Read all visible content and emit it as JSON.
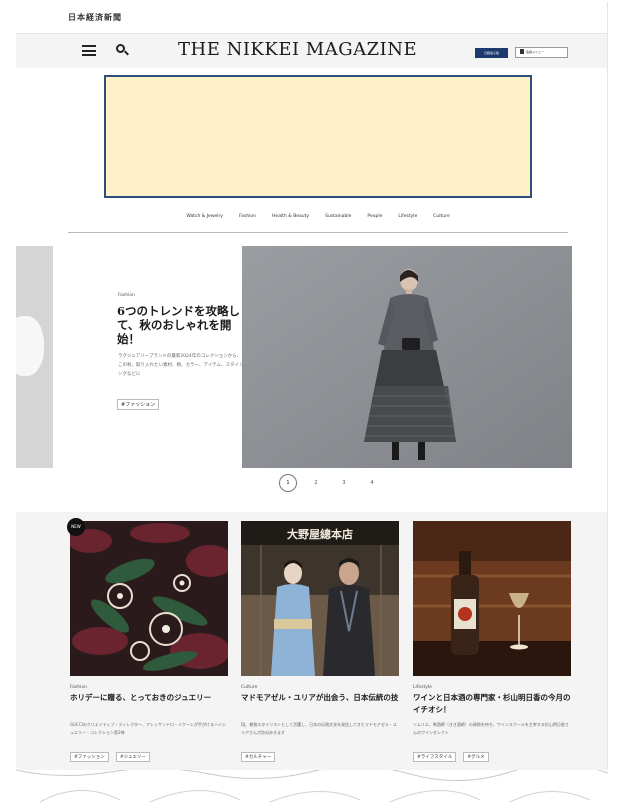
{
  "masthead": {
    "paper_name": "日本経済新聞"
  },
  "header": {
    "logo": "THE NIKKEI MAGAZINE",
    "subscribe_label": "日経電子版",
    "member_label": "会員メニュー"
  },
  "categories": [
    "Watch & Jewelry",
    "Fashion",
    "Health & Beauty",
    "Sustainable",
    "People",
    "Lifestyle",
    "Culture"
  ],
  "feature": {
    "category": "Fashion",
    "title": "6つのトレンドを攻略して、秋のおしゃれを開始！",
    "description": "ラグジュアリーブランドの最新2024年のコレクションから、この秋、取り入れたい素材、柄、カラー、アイテム、スタイリングなどに",
    "tag": "#ファッション"
  },
  "pagination": [
    "1",
    "2",
    "3",
    "4"
  ],
  "articles": [
    {
      "badge": "NEW",
      "category": "Fashion",
      "title": "ホリデーに贈る、とっておきのジュエリー",
      "description": "GUCCIのクリエイティブ・ディレクター、アレッサンドロ・ミケーレが手がけるハイジュエリー・コレクション第2弾",
      "tags": [
        "#ファッション",
        "#ジュエリー"
      ]
    },
    {
      "category": "Culture",
      "title": "マドモアゼル・ユリアが出会う、日本伝統の技",
      "description": "DJ、着物スタイリストとして活躍し、日本の伝統文化を発信してきたマドモアゼル・ユリアさんが訪ね歩きます",
      "tags": [
        "#カルチャー"
      ]
    },
    {
      "category": "Lifestyle",
      "title": "ワインと日本酒の専門家・杉山明日香の今月のイチオシ！",
      "description": "ソムリエ、唎酒師（きき酒師）の資格を持ち、ワインスクールを主宰する杉山明日香さんのワインセレクト",
      "tags": [
        "#ライフスタイル",
        "#グルメ"
      ]
    }
  ],
  "store_sign": "大野屋總本店"
}
